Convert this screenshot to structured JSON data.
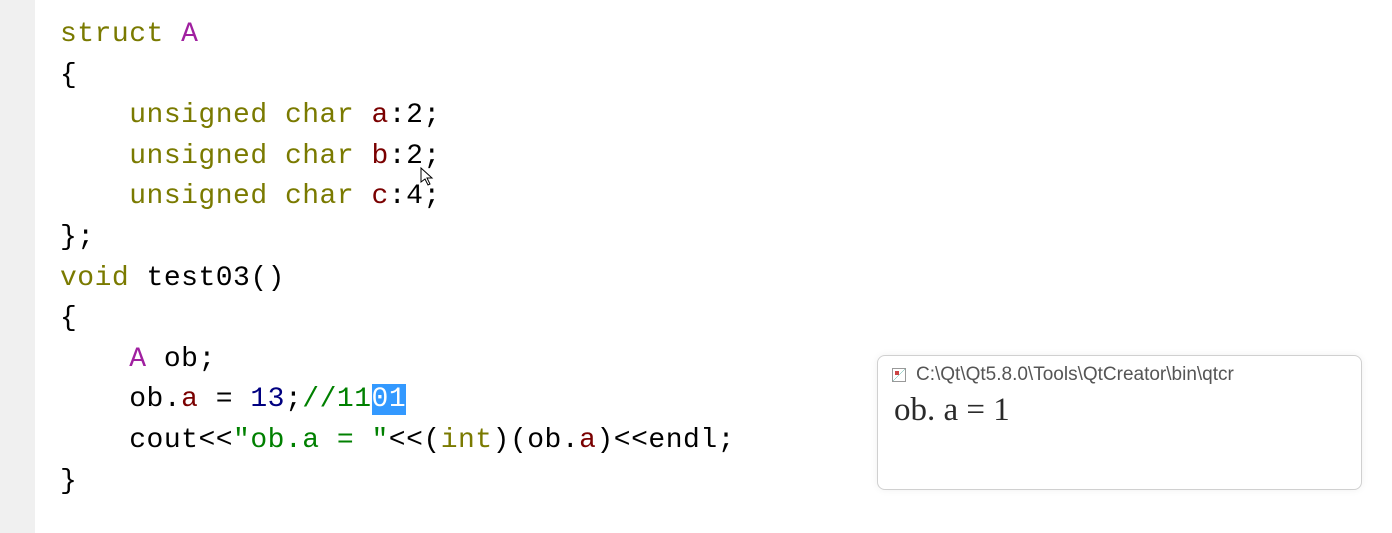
{
  "code": {
    "line1": {
      "kw_struct": "struct",
      "name": "A"
    },
    "line2": {
      "brace": "{"
    },
    "line3": {
      "kw_unsigned": "unsigned",
      "kw_char": "char",
      "var": "a",
      "bits": ":2;"
    },
    "line4": {
      "kw_unsigned": "unsigned",
      "kw_char": "char",
      "var": "b",
      "bits": ":2;"
    },
    "line5": {
      "kw_unsigned": "unsigned",
      "kw_char": "char",
      "var": "c",
      "bits": ":4;"
    },
    "line6": {
      "braceclose": "};"
    },
    "line7": {
      "kw_void": "void",
      "fn": "test03",
      "parens": "()"
    },
    "line8": {
      "brace": "{"
    },
    "line9": {
      "type": "A",
      "var": "ob",
      "semi": ";"
    },
    "line10": {
      "obj": "ob",
      "dot": ".",
      "field": "a",
      "eq": " = ",
      "num": "13",
      "semi": ";",
      "comment_pre": "//11",
      "comment_sel": "01"
    },
    "line11": {
      "cout": "cout",
      "sh1": "<<",
      "str": "\"ob.a = \"",
      "sh2": "<<",
      "cast_open": "(",
      "cast_type": "int",
      "cast_close": ")",
      "paren_open": "(",
      "obj": "ob",
      "dot": ".",
      "field": "a",
      "paren_close": ")",
      "sh3": "<<",
      "endl": "endl",
      "semi": ";"
    },
    "line12": {
      "brace": "}"
    }
  },
  "console": {
    "title": "C:\\Qt\\Qt5.8.0\\Tools\\QtCreator\\bin\\qtcr",
    "output": "ob. a  =  1"
  }
}
